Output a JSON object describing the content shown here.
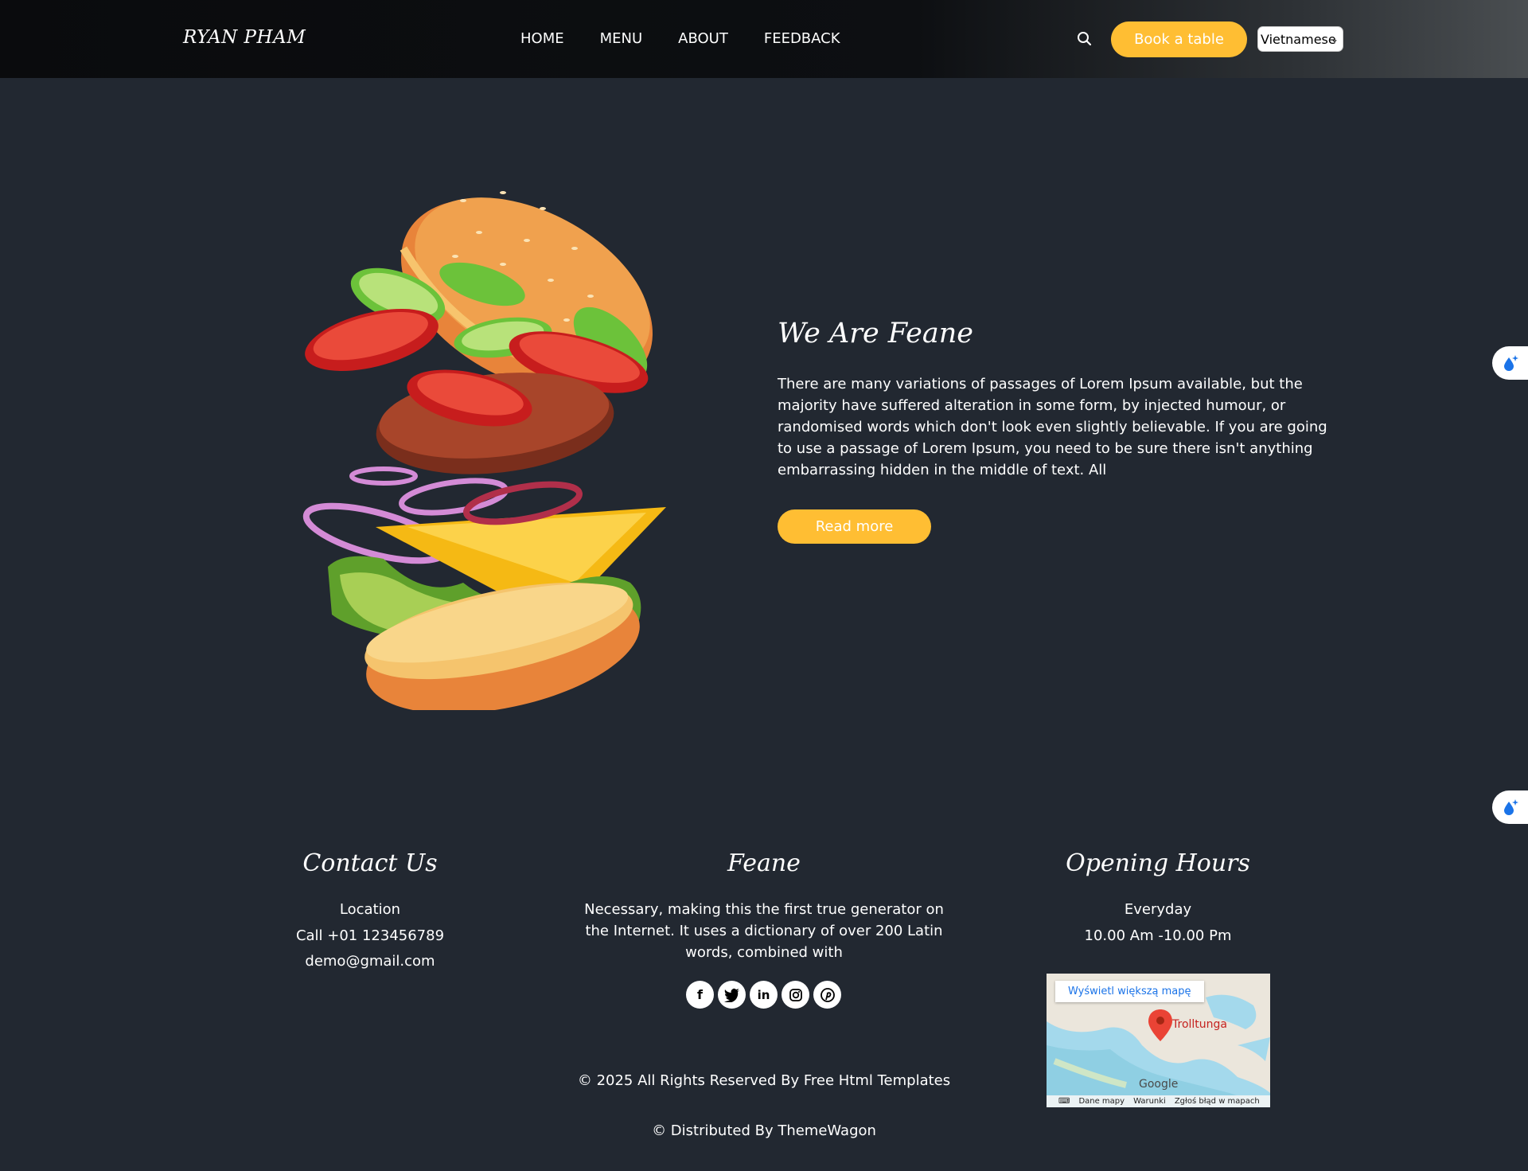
{
  "header": {
    "brand": "RYAN PHAM",
    "nav": [
      "HOME",
      "MENU",
      "ABOUT",
      "FEEDBACK"
    ],
    "book_label": "Book a table",
    "language": "Vietnamese"
  },
  "about": {
    "title": "We Are Feane",
    "text": "There are many variations of passages of Lorem Ipsum available, but the majority have suffered alteration in some form, by injected humour, or randomised words which don't look even slightly believable. If you are going to use a passage of Lorem Ipsum, you need to be sure there isn't anything embarrassing hidden in the middle of text. All",
    "read_more": "Read more"
  },
  "footer": {
    "contact": {
      "title": "Contact Us",
      "location": "Location",
      "phone": "Call +01 123456789",
      "email": "demo@gmail.com"
    },
    "feane": {
      "title": "Feane",
      "text": "Necessary, making this the first true generator on the Internet. It uses a dictionary of over 200 Latin words, combined with",
      "social": [
        "f",
        "t",
        "in",
        "ig",
        "p"
      ]
    },
    "hours": {
      "title": "Opening Hours",
      "days": "Everyday",
      "time": "10.00 Am -10.00 Pm"
    },
    "map": {
      "link": "Wyświetl większą mapę",
      "place": "Trolltunga",
      "logo": "Google",
      "footer_items": [
        "Dane mapy",
        "Warunki",
        "Zgłoś błąd w mapach"
      ]
    },
    "copyright": "© 2025 All Rights Reserved By Free Html Templates",
    "distributed": "© Distributed By ThemeWagon"
  },
  "colors": {
    "background": "#222831",
    "accent": "#ffbe33",
    "header": "#0d0f12"
  }
}
